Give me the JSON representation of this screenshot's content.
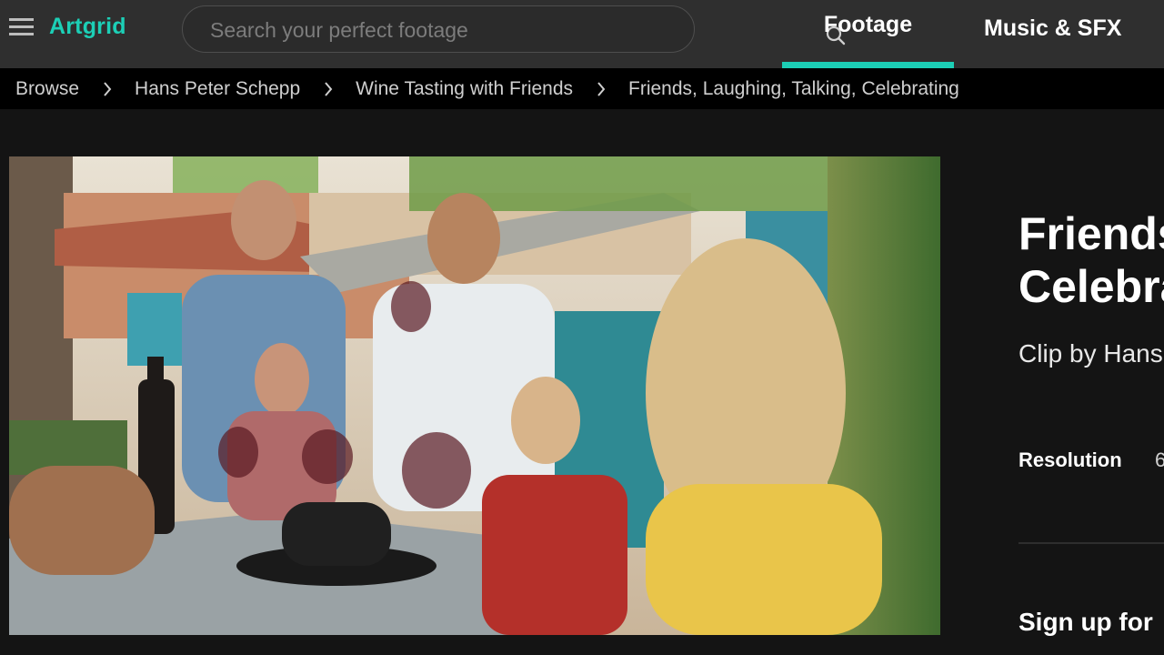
{
  "header": {
    "logo_text": "Artgrid",
    "search": {
      "placeholder": "Search your perfect footage",
      "value": ""
    },
    "tabs": [
      {
        "label": "Footage",
        "active": true
      },
      {
        "label": "Music & SFX",
        "active": false
      }
    ],
    "accent_color": "#1ccfb6"
  },
  "breadcrumb": [
    "Browse",
    "Hans Peter Schepp",
    "Wine Tasting with Friends",
    "Friends, Laughing, Talking, Celebrating"
  ],
  "clip": {
    "title_line1": "Friends",
    "title_line2": "Celebra",
    "clip_by": "Clip by Hans",
    "resolution_label": "Resolution",
    "resolution_value": "6",
    "signup": "Sign up for"
  },
  "icons": {
    "menu": "hamburger-icon",
    "search": "search-icon",
    "breadcrumb_separator": "chevron-right-icon"
  }
}
